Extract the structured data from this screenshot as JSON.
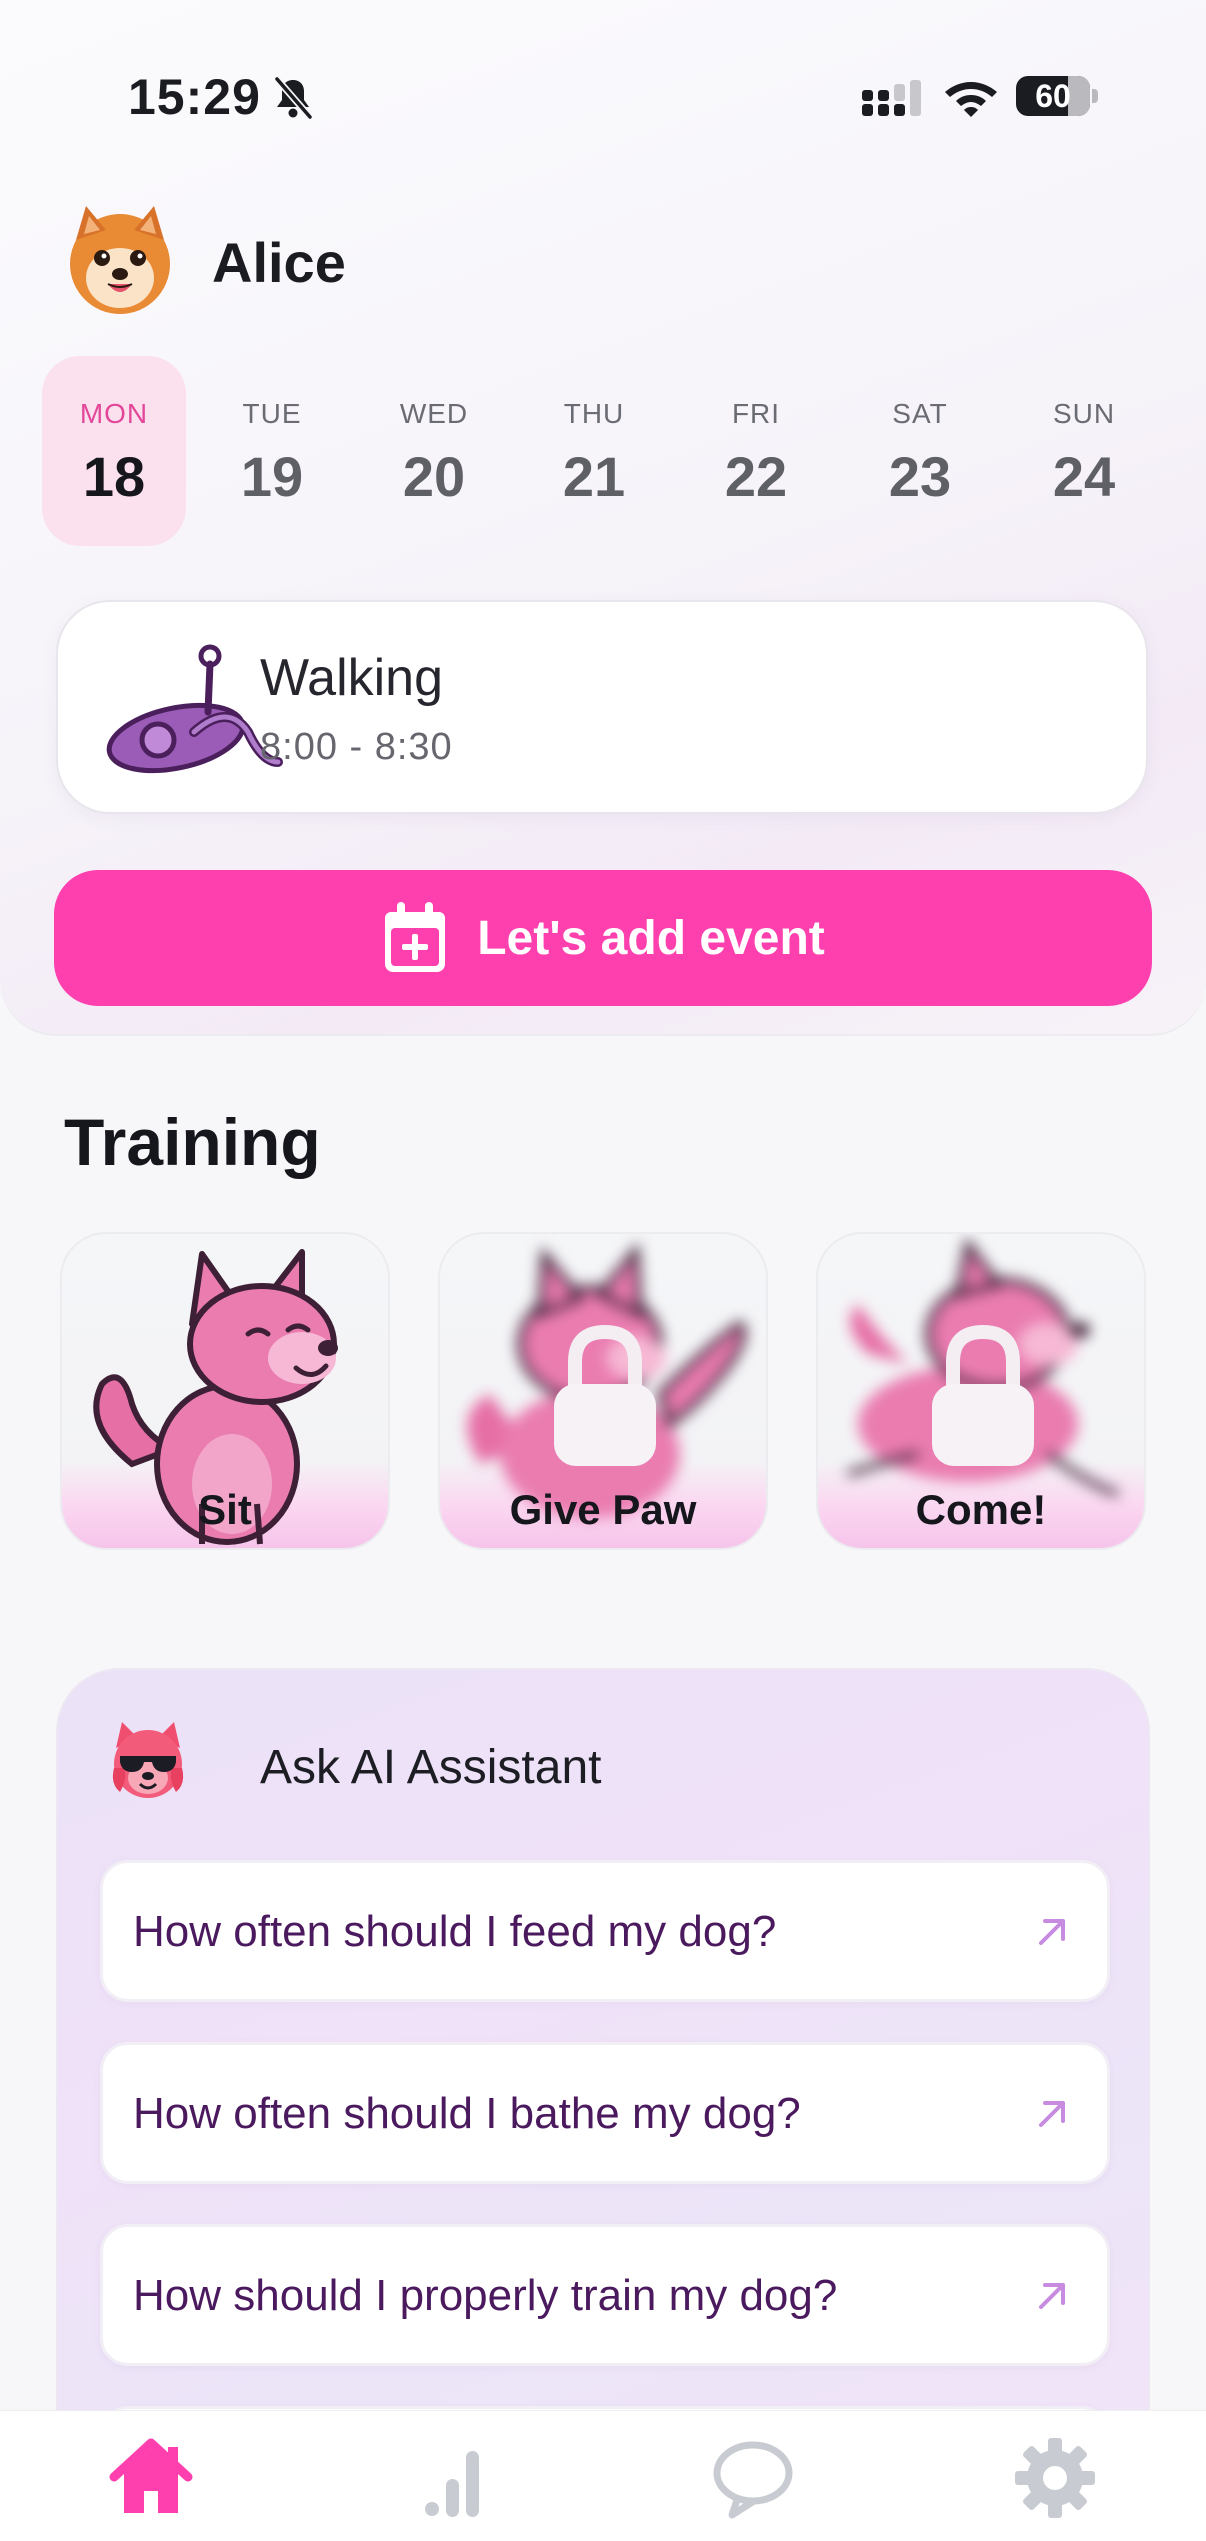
{
  "status_bar": {
    "time": "15:29",
    "battery": "60",
    "icons": [
      "bell-slash-icon",
      "signal-icon",
      "wifi-icon",
      "battery-icon"
    ]
  },
  "profile": {
    "name": "Alice",
    "avatar_icon": "pomeranian-avatar-icon"
  },
  "week": {
    "days": [
      {
        "name": "MON",
        "num": "18",
        "selected": true
      },
      {
        "name": "TUE",
        "num": "19",
        "selected": false
      },
      {
        "name": "WED",
        "num": "20",
        "selected": false
      },
      {
        "name": "THU",
        "num": "21",
        "selected": false
      },
      {
        "name": "FRI",
        "num": "22",
        "selected": false
      },
      {
        "name": "SAT",
        "num": "23",
        "selected": false
      },
      {
        "name": "SUN",
        "num": "24",
        "selected": false
      }
    ]
  },
  "event": {
    "title": "Walking",
    "time": "8:00 - 8:30",
    "icon": "leash-icon"
  },
  "add_event": {
    "label": "Let's add event",
    "icon": "calendar-plus-icon"
  },
  "training": {
    "title": "Training",
    "items": [
      {
        "label": "Sit",
        "locked": false
      },
      {
        "label": "Give Paw",
        "locked": true
      },
      {
        "label": "Come!",
        "locked": true
      }
    ]
  },
  "assistant": {
    "title": "Ask AI Assistant",
    "questions": [
      "How often should I feed my dog?",
      "How often should I bathe my dog?",
      "How should I properly train my dog?"
    ]
  },
  "tab_bar": {
    "tabs": [
      "home-icon",
      "stats-icon",
      "chat-icon",
      "settings-icon"
    ],
    "active": "home-icon"
  },
  "colors": {
    "accent": "#fd40ae",
    "selected_day_bg": "#fbe1ee",
    "question_text": "#4b1a5e"
  }
}
